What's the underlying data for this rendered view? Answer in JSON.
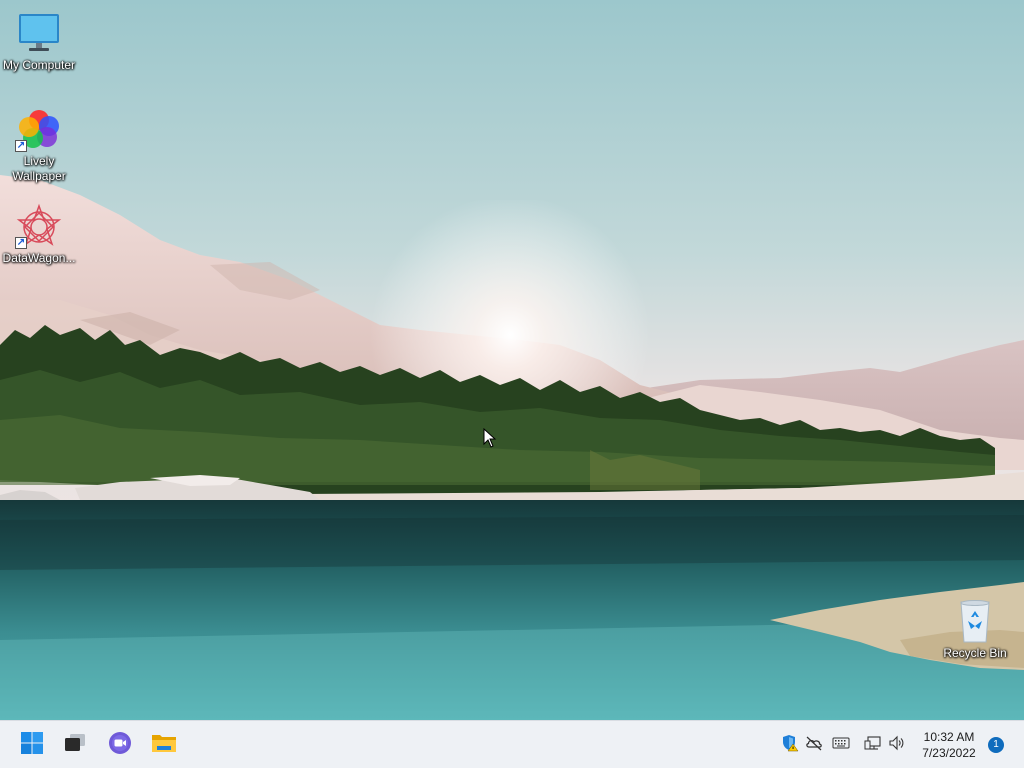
{
  "desktop": {
    "icons": [
      {
        "label": "My Computer",
        "icon": "monitor-icon"
      },
      {
        "label": "Lively Wallpaper",
        "icon": "lively-wallpaper-icon",
        "shortcut": true
      },
      {
        "label": "DataWagon...",
        "icon": "datawagon-icon",
        "shortcut": true
      },
      {
        "label": "Recycle Bin",
        "icon": "recycle-bin-icon"
      }
    ]
  },
  "taskbar": {
    "pinned": [
      {
        "icon": "windows-start-icon"
      },
      {
        "icon": "task-view-icon"
      },
      {
        "icon": "teams-chat-icon"
      },
      {
        "icon": "file-explorer-icon"
      }
    ],
    "tray": [
      {
        "icon": "windows-security-warning-icon"
      },
      {
        "icon": "onedrive-offline-icon"
      },
      {
        "icon": "keyboard-icon"
      },
      {
        "icon": "network-icon"
      },
      {
        "icon": "volume-icon"
      }
    ],
    "clock": {
      "time": "10:32 AM",
      "date": "7/23/2022"
    },
    "notification_count": "1"
  },
  "colors": {
    "taskbar_bg": "#eef1f5",
    "accent": "#0f6cbd"
  }
}
